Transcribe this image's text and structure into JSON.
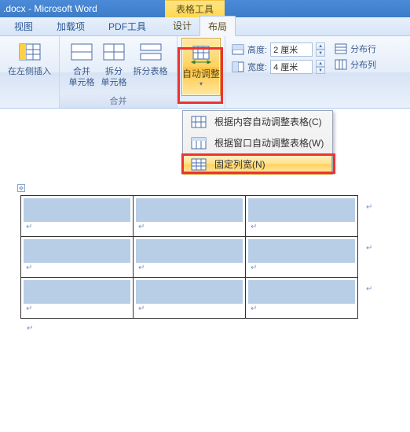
{
  "title_bar": ".docx - Microsoft Word",
  "tool_context": "表格工具",
  "tabs": {
    "view": "视图",
    "addin": "加载项",
    "pdf": "PDF工具",
    "design": "设计",
    "layout": "布局"
  },
  "ribbon": {
    "insert_left": "在左侧插入",
    "merge_cell": "合并\n单元格",
    "split_cell": "拆分\n单元格",
    "split_table": "拆分表格",
    "merge_group": "合并",
    "auto_fit": "自动调整",
    "height_lbl": "高度:",
    "height_val": "2 厘米",
    "width_lbl": "宽度:",
    "width_val": "4 厘米",
    "dist_rows": "分布行",
    "dist_cols": "分布列"
  },
  "menu": {
    "fit_content": "根据内容自动调整表格(C)",
    "fit_window": "根据窗口自动调整表格(W)",
    "fixed_width": "固定列宽(N)"
  }
}
